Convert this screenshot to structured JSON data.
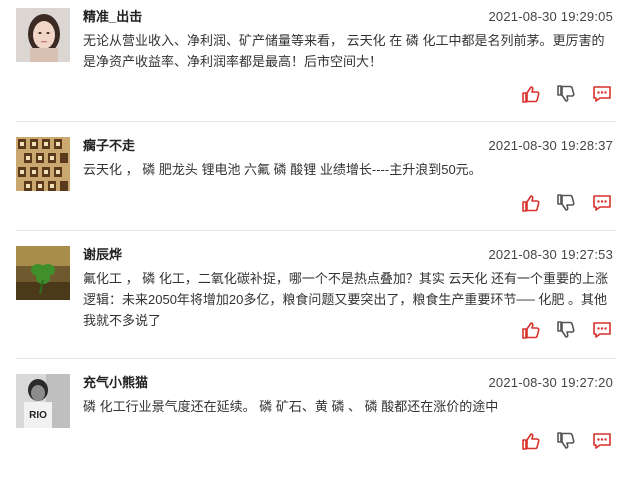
{
  "comments": [
    {
      "username": "精准_出击",
      "timestamp": "2021-08-30 19:29:05",
      "text": "无论从营业收入、净利润、矿产储量等来看， 云天化 在 磷 化工中都是名列前茅。更厉害的是净资产收益率、净利润率都是最高！后市空间大！",
      "avatar": "portrait-woman",
      "icons": [
        "thumbs-up-icon",
        "thumbs-down-icon",
        "comment-icon"
      ]
    },
    {
      "username": "瘸子不走",
      "timestamp": "2021-08-30 19:28:37",
      "text": "云天化 ， 磷 肥龙头 锂电池 六氟 磷 酸锂 业绩增长----主升浪到50元。",
      "avatar": "pattern-tiles",
      "icons": [
        "thumbs-up-icon",
        "thumbs-down-icon",
        "comment-icon"
      ]
    },
    {
      "username": "谢辰烨",
      "timestamp": "2021-08-30 19:27:53",
      "text": "氟化工 ， 磷 化工，二氧化碳补捉，哪一个不是热点叠加？其实 云天化 还有一个重要的上涨逻辑：未来2050年将增加20多亿，粮食问题又要突出了，粮食生产重要环节── 化肥 。其他我就不多说了",
      "avatar": "clover-leaf",
      "icons": [
        "thumbs-up-icon",
        "thumbs-down-icon",
        "comment-icon"
      ]
    },
    {
      "username": "充气小熊猫",
      "timestamp": "2021-08-30 19:27:20",
      "text": "磷 化工行业景气度还在延续。 磷 矿石、黄 磷 、 磷 酸都还在涨价的途中",
      "avatar": "bw-photo",
      "icons": [
        "thumbs-up-icon",
        "thumbs-down-icon",
        "comment-icon"
      ]
    }
  ],
  "colors": {
    "icon_red": "#d9312b",
    "icon_gray": "#555555",
    "divider": "#e6e6e6"
  }
}
